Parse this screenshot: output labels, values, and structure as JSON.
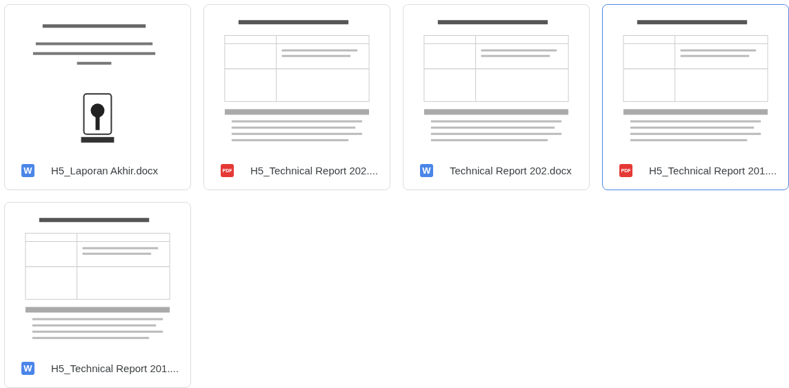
{
  "files": [
    {
      "name": "H5_Laporan Akhir.docx",
      "kind": "word",
      "badge": "W",
      "selected": false
    },
    {
      "name": "H5_Technical Report 202....",
      "kind": "pdf",
      "badge": "PDF",
      "selected": false
    },
    {
      "name": "Technical Report 202.docx",
      "kind": "word",
      "badge": "W",
      "selected": false
    },
    {
      "name": "H5_Technical Report 201....",
      "kind": "pdf",
      "badge": "PDF",
      "selected": true
    },
    {
      "name": "H5_Technical Report 201....",
      "kind": "word",
      "badge": "W",
      "selected": false
    }
  ]
}
